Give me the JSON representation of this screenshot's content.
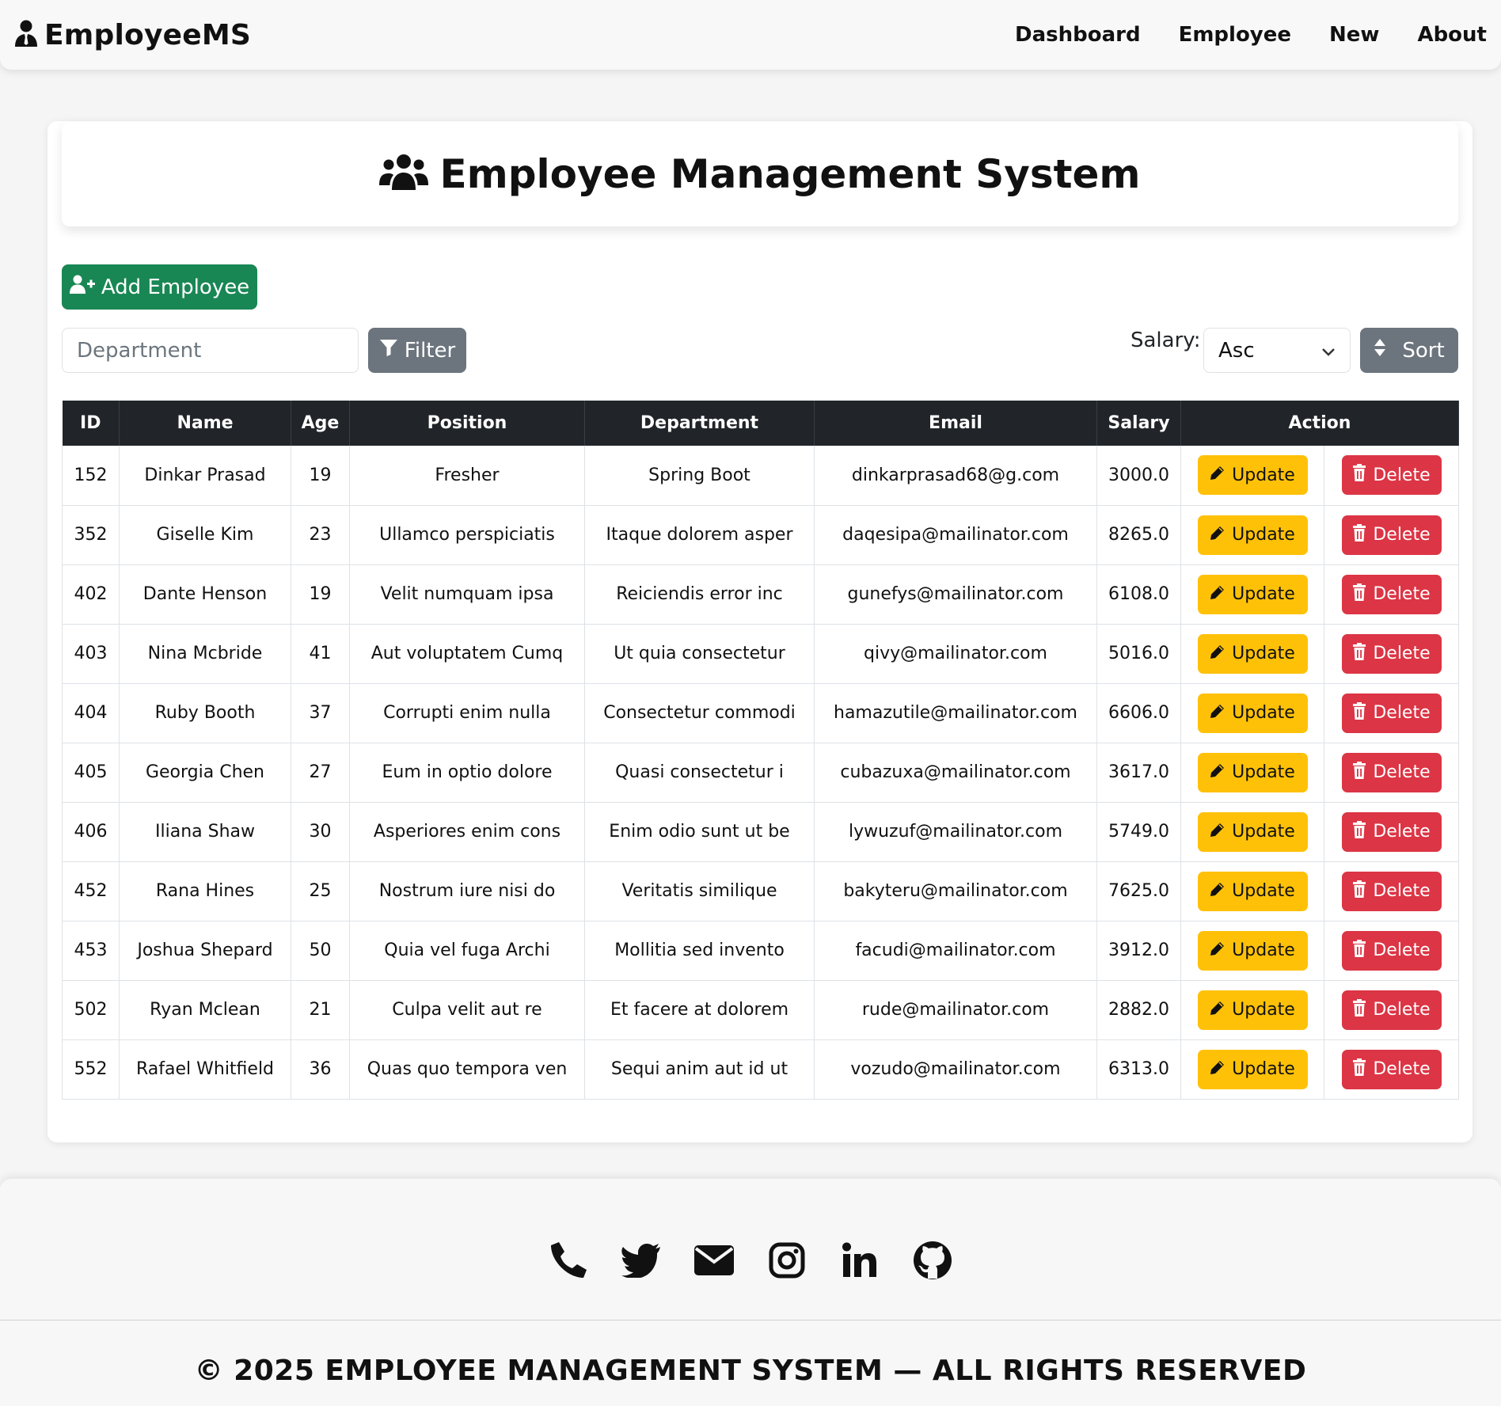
{
  "navbar": {
    "brand": "EmployeeMS",
    "links": [
      "Dashboard",
      "Employee",
      "New",
      "About"
    ]
  },
  "header": {
    "title": "Employee Management System"
  },
  "toolbar": {
    "add_label": "Add Employee",
    "department_placeholder": "Department",
    "filter_label": "Filter",
    "salary_label": "Salary:",
    "sort_value": "Asc",
    "sort_label": "Sort"
  },
  "table": {
    "columns": [
      "ID",
      "Name",
      "Age",
      "Position",
      "Department",
      "Email",
      "Salary",
      "Action"
    ],
    "update_label": "Update",
    "delete_label": "Delete",
    "rows": [
      {
        "id": "152",
        "name": "Dinkar Prasad",
        "age": "19",
        "position": "Fresher",
        "department": "Spring Boot",
        "email": "dinkarprasad68@g.com",
        "salary": "3000.0"
      },
      {
        "id": "352",
        "name": "Giselle Kim",
        "age": "23",
        "position": "Ullamco perspiciatis",
        "department": "Itaque dolorem asper",
        "email": "daqesipa@mailinator.com",
        "salary": "8265.0"
      },
      {
        "id": "402",
        "name": "Dante Henson",
        "age": "19",
        "position": "Velit numquam ipsa",
        "department": "Reiciendis error inc",
        "email": "gunefys@mailinator.com",
        "salary": "6108.0"
      },
      {
        "id": "403",
        "name": "Nina Mcbride",
        "age": "41",
        "position": "Aut voluptatem Cumq",
        "department": "Ut quia consectetur",
        "email": "qivy@mailinator.com",
        "salary": "5016.0"
      },
      {
        "id": "404",
        "name": "Ruby Booth",
        "age": "37",
        "position": "Corrupti enim nulla",
        "department": "Consectetur commodi",
        "email": "hamazutile@mailinator.com",
        "salary": "6606.0"
      },
      {
        "id": "405",
        "name": "Georgia Chen",
        "age": "27",
        "position": "Eum in optio dolore",
        "department": "Quasi consectetur i",
        "email": "cubazuxa@mailinator.com",
        "salary": "3617.0"
      },
      {
        "id": "406",
        "name": "Iliana Shaw",
        "age": "30",
        "position": "Asperiores enim cons",
        "department": "Enim odio sunt ut be",
        "email": "lywuzuf@mailinator.com",
        "salary": "5749.0"
      },
      {
        "id": "452",
        "name": "Rana Hines",
        "age": "25",
        "position": "Nostrum iure nisi do",
        "department": "Veritatis similique",
        "email": "bakyteru@mailinator.com",
        "salary": "7625.0"
      },
      {
        "id": "453",
        "name": "Joshua Shepard",
        "age": "50",
        "position": "Quia vel fuga Archi",
        "department": "Mollitia sed invento",
        "email": "facudi@mailinator.com",
        "salary": "3912.0"
      },
      {
        "id": "502",
        "name": "Ryan Mclean",
        "age": "21",
        "position": "Culpa velit aut re",
        "department": "Et facere at dolorem",
        "email": "rude@mailinator.com",
        "salary": "2882.0"
      },
      {
        "id": "552",
        "name": "Rafael Whitfield",
        "age": "36",
        "position": "Quas quo tempora ven",
        "department": "Sequi anim aut id ut",
        "email": "vozudo@mailinator.com",
        "salary": "6313.0"
      }
    ]
  },
  "footer": {
    "social_icons": [
      "phone-icon",
      "twitter-icon",
      "envelope-icon",
      "instagram-icon",
      "linkedin-icon",
      "github-icon"
    ],
    "copyright": "© 2025 EMPLOYEE MANAGEMENT SYSTEM — ALL RIGHTS RESERVED"
  },
  "colors": {
    "add_button": "#198754",
    "secondary_button": "#6c757d",
    "update_button": "#ffc107",
    "delete_button": "#dc3545",
    "table_header": "#212529"
  }
}
